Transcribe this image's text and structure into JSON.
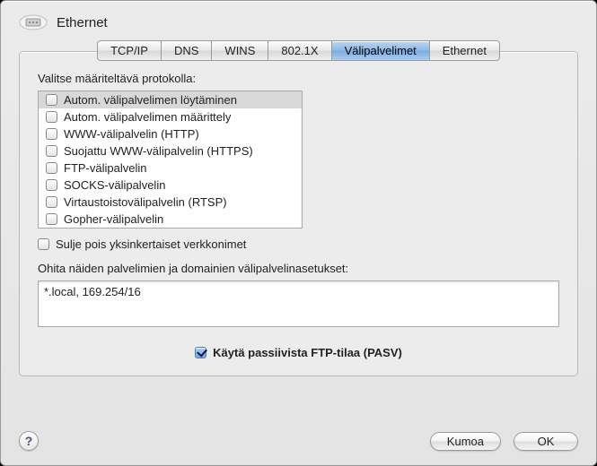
{
  "header": {
    "title": "Ethernet"
  },
  "tabs": [
    {
      "label": "TCP/IP",
      "selected": false
    },
    {
      "label": "DNS",
      "selected": false
    },
    {
      "label": "WINS",
      "selected": false
    },
    {
      "label": "802.1X",
      "selected": false
    },
    {
      "label": "Välipalvelimet",
      "selected": true
    },
    {
      "label": "Ethernet",
      "selected": false
    }
  ],
  "proxies": {
    "section_label": "Valitse määriteltävä protokolla:",
    "items": [
      {
        "label": "Autom. välipalvelimen löytäminen",
        "checked": false,
        "selected": true
      },
      {
        "label": "Autom. välipalvelimen määrittely",
        "checked": false,
        "selected": false
      },
      {
        "label": "WWW-välipalvelin (HTTP)",
        "checked": false,
        "selected": false
      },
      {
        "label": "Suojattu WWW-välipalvelin (HTTPS)",
        "checked": false,
        "selected": false
      },
      {
        "label": "FTP-välipalvelin",
        "checked": false,
        "selected": false
      },
      {
        "label": "SOCKS-välipalvelin",
        "checked": false,
        "selected": false
      },
      {
        "label": "Virtaustoistovälipalvelin (RTSP)",
        "checked": false,
        "selected": false
      },
      {
        "label": "Gopher-välipalvelin",
        "checked": false,
        "selected": false
      }
    ],
    "exclude_simple": {
      "label": "Sulje pois yksinkertaiset verkkonimet",
      "checked": false
    },
    "bypass_label": "Ohita näiden palvelimien ja domainien välipalvelinasetukset:",
    "bypass_value": "*.local, 169.254/16",
    "pasv": {
      "label": "Käytä passiivista FTP-tilaa (PASV)",
      "checked": true
    }
  },
  "buttons": {
    "cancel": "Kumoa",
    "ok": "OK",
    "help": "?"
  }
}
